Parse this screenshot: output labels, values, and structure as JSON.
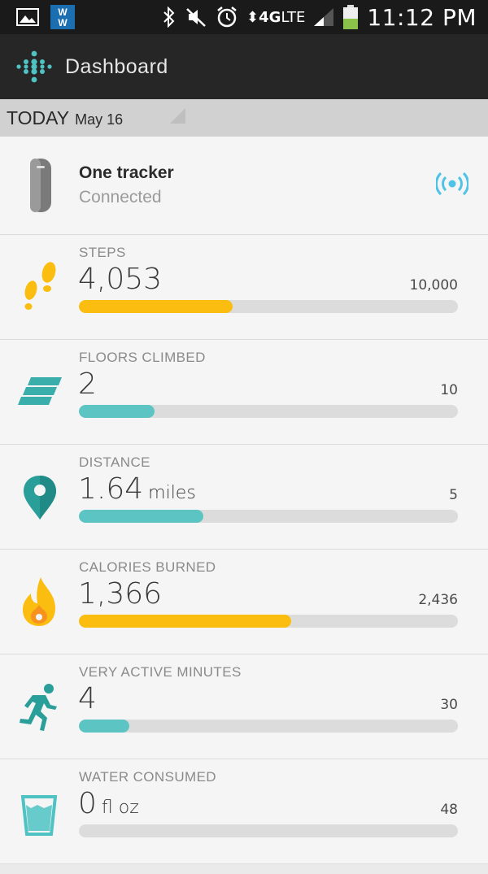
{
  "status_bar": {
    "network": "4G",
    "network_suffix": "LTE",
    "time": "11:12 PM",
    "icons": [
      "gallery-icon",
      "weight-watchers-icon",
      "bluetooth-icon",
      "mute-icon",
      "alarm-icon",
      "signal-icon",
      "battery-icon"
    ]
  },
  "app_bar": {
    "title": "Dashboard"
  },
  "date_bar": {
    "label": "TODAY",
    "date": "May 16"
  },
  "tracker": {
    "name": "One tracker",
    "status": "Connected"
  },
  "colors": {
    "yellow": "#fbbd0f",
    "teal": "#5cc5c3",
    "teal_dark": "#2a9e99",
    "sync": "#4fc3e6"
  },
  "stats": [
    {
      "label": "STEPS",
      "value": "4,053",
      "unit": "",
      "goal": "10,000",
      "progress": 0.405,
      "color": "yellow",
      "icon": "footsteps-icon"
    },
    {
      "label": "FLOORS CLIMBED",
      "value": "2",
      "unit": "",
      "goal": "10",
      "progress": 0.2,
      "color": "teal",
      "icon": "stairs-icon"
    },
    {
      "label": "DISTANCE",
      "value": "1.64",
      "unit": "miles",
      "goal": "5",
      "progress": 0.328,
      "color": "teal",
      "icon": "location-pin-icon"
    },
    {
      "label": "CALORIES BURNED",
      "value": "1,366",
      "unit": "",
      "goal": "2,436",
      "progress": 0.561,
      "color": "yellow",
      "icon": "flame-icon"
    },
    {
      "label": "VERY ACTIVE MINUTES",
      "value": "4",
      "unit": "",
      "goal": "30",
      "progress": 0.133,
      "color": "teal",
      "icon": "running-person-icon"
    },
    {
      "label": "WATER CONSUMED",
      "value": "0",
      "unit": "fl oz",
      "goal": "48",
      "progress": 0,
      "color": "teal",
      "icon": "water-glass-icon"
    }
  ]
}
